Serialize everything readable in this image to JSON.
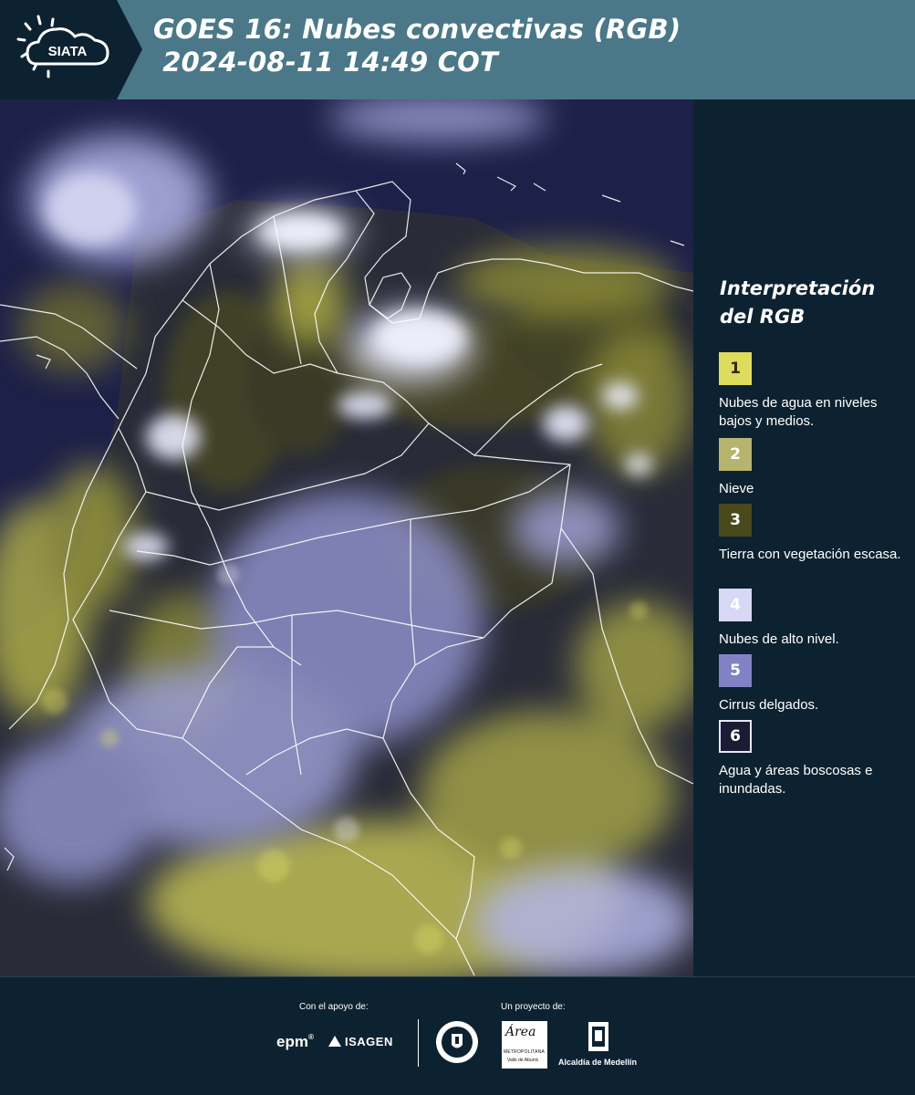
{
  "header": {
    "logo_text": "SIATA",
    "title_line1": "GOES 16: Nubes convectivas (RGB)",
    "title_line2": " 2024-08-11 14:49 COT"
  },
  "legend": {
    "title": "Interpretación del RGB",
    "items": [
      {
        "num": "1",
        "color": "#dedc5a",
        "text_color": "#2a2a10",
        "label": "Nubes de agua en niveles bajos y medios."
      },
      {
        "num": "2",
        "color": "#b7b46e",
        "text_color": "#ffffff",
        "label": "Nieve"
      },
      {
        "num": "3",
        "color": "#4a491c",
        "text_color": "#ffffff",
        "label": "Tierra con vegetación escasa."
      },
      {
        "num": "4",
        "color": "#d7d8f6",
        "text_color": "#ffffff",
        "label": "Nubes de alto nivel."
      },
      {
        "num": "5",
        "color": "#8182c6",
        "text_color": "#ffffff",
        "label": "Cirrus delgados."
      },
      {
        "num": "6",
        "color": "#1b1c33",
        "text_color": "#ffffff",
        "label": "Agua y áreas boscosas e inundadas."
      }
    ]
  },
  "footer": {
    "support_label": "Con el apoyo de:",
    "project_label": "Un proyecto de:",
    "sponsor_1": "epm",
    "sponsor_2": "ISAGEN",
    "partner_1_top": "Área",
    "partner_1_bottom": "METROPOLITANA",
    "partner_1_sub": "Valle de Aburrá",
    "partner_2": "Alcaldía de Medellín"
  },
  "colors": {
    "header_bg": "#4a7888",
    "page_bg": "#0d2230",
    "map_bg": "#1c1f4a",
    "low_cloud": "#dedc5a",
    "high_cloud": "#d7d8f6",
    "border_line": "#ffffff"
  }
}
